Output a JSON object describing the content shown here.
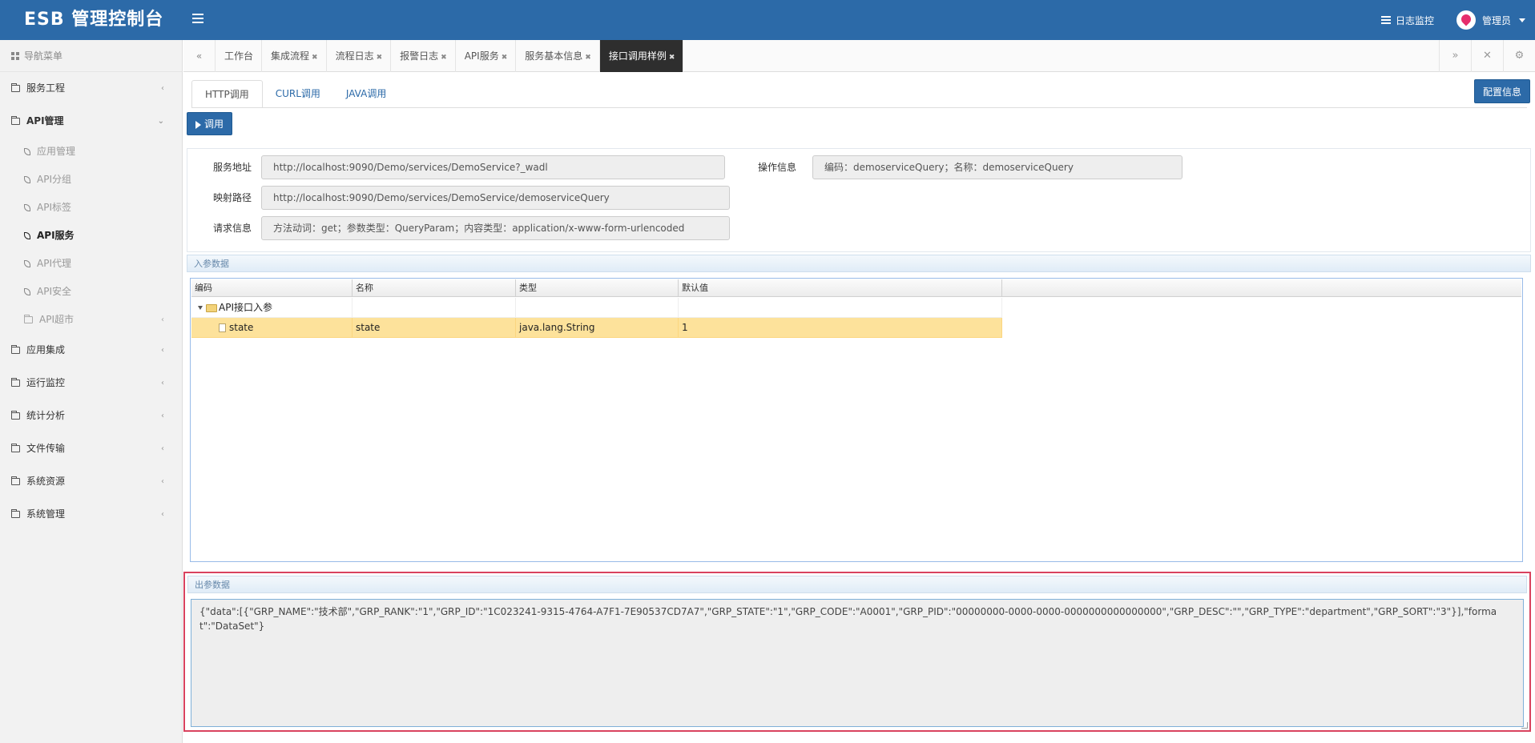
{
  "header": {
    "title": "ESB 管理控制台",
    "log_monitor": "日志监控",
    "user": "管理员"
  },
  "sidebar": {
    "nav_title": "导航菜单",
    "items": [
      {
        "label": "服务工程"
      },
      {
        "label": "API管理"
      },
      {
        "label": "应用集成"
      },
      {
        "label": "运行监控"
      },
      {
        "label": "统计分析"
      },
      {
        "label": "文件传输"
      },
      {
        "label": "系统资源"
      },
      {
        "label": "系统管理"
      }
    ],
    "api_sub": [
      {
        "label": "应用管理"
      },
      {
        "label": "API分组"
      },
      {
        "label": "API标签"
      },
      {
        "label": "API服务"
      },
      {
        "label": "API代理"
      },
      {
        "label": "API安全"
      },
      {
        "label": "API超市"
      }
    ]
  },
  "tabs": [
    {
      "label": "工作台"
    },
    {
      "label": "集成流程"
    },
    {
      "label": "流程日志"
    },
    {
      "label": "报警日志"
    },
    {
      "label": "API服务"
    },
    {
      "label": "服务基本信息"
    },
    {
      "label": "接口调用样例"
    }
  ],
  "subtabs": [
    {
      "label": "HTTP调用"
    },
    {
      "label": "CURL调用"
    },
    {
      "label": "JAVA调用"
    }
  ],
  "buttons": {
    "config": "配置信息",
    "invoke": "调用"
  },
  "info": {
    "service_addr_label": "服务地址",
    "service_addr_value": "http://localhost:9090/Demo/services/DemoService?_wadl",
    "op_info_label": "操作信息",
    "op_info_value": "编码：demoserviceQuery；名称：demoserviceQuery",
    "mapping_label": "映射路径",
    "mapping_value": "http://localhost:9090/Demo/services/DemoService/demoserviceQuery",
    "request_label": "请求信息",
    "request_value": "方法动词：get；参数类型：QueryParam；内容类型：application/x-www-form-urlencoded"
  },
  "input_section": {
    "title": "入参数据",
    "columns": [
      "编码",
      "名称",
      "类型",
      "默认值"
    ],
    "root": {
      "code": "API接口入参"
    },
    "rows": [
      {
        "code": "state",
        "name": "state",
        "type": "java.lang.String",
        "default": "1"
      }
    ]
  },
  "output_section": {
    "title": "出参数据",
    "json_text": "{\"data\":[{\"GRP_NAME\":\"技术部\",\"GRP_RANK\":\"1\",\"GRP_ID\":\"1C023241-9315-4764-A7F1-7E90537CD7A7\",\"GRP_STATE\":\"1\",\"GRP_CODE\":\"A0001\",\"GRP_PID\":\"00000000-0000-0000-0000000000000000\",\"GRP_DESC\":\"\",\"GRP_TYPE\":\"department\",\"GRP_SORT\":\"3\"}],\"format\":\"DataSet\"}"
  },
  "colors": {
    "brand": "#2c6aa8",
    "highlight_border": "#d9425e",
    "selected_row": "#fde29b"
  }
}
